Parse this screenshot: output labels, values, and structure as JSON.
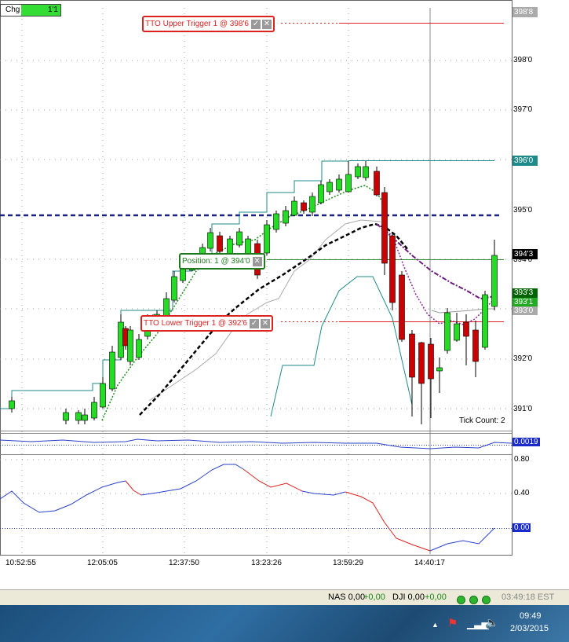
{
  "chg_label": "Chg",
  "chg_value": "1'1",
  "price_axis": [
    "398'0",
    "397'0",
    "395'0",
    "394'0",
    "392'0",
    "391'0"
  ],
  "price_tags": [
    {
      "text": "398'8",
      "bg": "#aaaaaa",
      "fg": "#ffffff"
    },
    {
      "text": "396'0",
      "bg": "#1f8a8a",
      "fg": "#ffffff"
    },
    {
      "text": "394'3",
      "bg": "#000000",
      "fg": "#ffffff"
    },
    {
      "text": "393'3",
      "bg": "#006400",
      "fg": "#ffffff"
    },
    {
      "text": "393'1",
      "bg": "#22aa22",
      "fg": "#ffffff"
    },
    {
      "text": "393'0",
      "bg": "#aaaaaa",
      "fg": "#ffffff"
    }
  ],
  "orders": {
    "upper_trigger": "TTO Upper Trigger 1 @ 398'6",
    "position": "Position: 1 @ 394'0",
    "lower_trigger": "TTO Lower Trigger 1 @ 392'6"
  },
  "tick_count": "Tick Count:  2",
  "sub1_value": "0.0019",
  "sub2_axis": [
    "0.80",
    "0.40",
    "0.00"
  ],
  "time_axis": [
    "10:52:55",
    "12:05:05",
    "12:37:50",
    "13:23:26",
    "13:59:29",
    "14:40:17"
  ],
  "status_bar": {
    "nas_label": "NAS 0,00",
    "nas_change": "+0,00",
    "dji_label": "DJI 0,00",
    "dji_change": "+0,00",
    "time": "03:49:18 EST"
  },
  "taskbar": {
    "clock_time": "09:49",
    "clock_date": "2/03/2015"
  },
  "colors": {
    "bull": "#22dd22",
    "bear": "#cc0000",
    "trigger": "#dd2222",
    "position": "#1f7a1f",
    "dashed_line": "#1a237e",
    "teal": "#1f8a8a"
  }
}
